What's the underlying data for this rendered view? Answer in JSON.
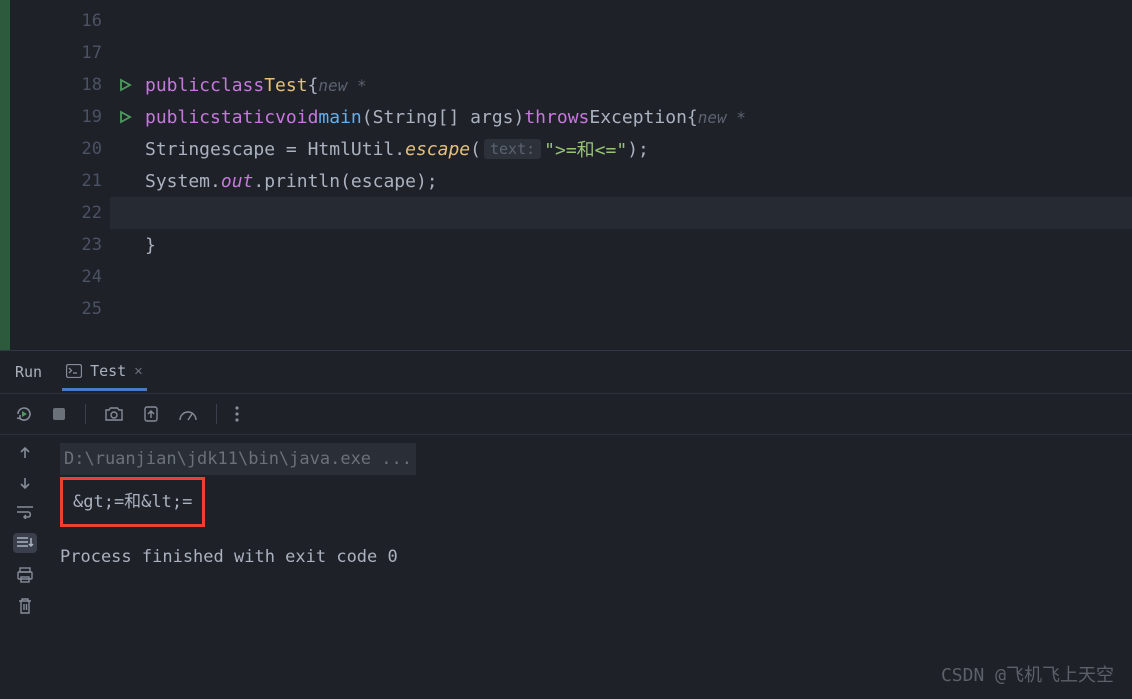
{
  "gutter": {
    "lines": [
      "16",
      "17",
      "18",
      "19",
      "20",
      "21",
      "22",
      "23",
      "24",
      "25"
    ]
  },
  "code": {
    "line18": {
      "kw1": "public",
      "kw2": "class",
      "name": "Test",
      "brace": "{",
      "hint": "new *"
    },
    "line19": {
      "kw1": "public",
      "kw2": "static",
      "kw3": "void",
      "method": "main",
      "params": "(String[] args)",
      "throws": "throws",
      "exc": "Exception",
      "brace": "{",
      "hint": "new *"
    },
    "line20": {
      "type": "String",
      "var": "escape",
      "eq": " = ",
      "cls": "HtmlUtil",
      "dot": ".",
      "method": "escape",
      "open": "(",
      "hint": "text:",
      "str": "\">=和<=\"",
      "close": ");"
    },
    "line21": {
      "sys": "System",
      "dot1": ".",
      "out": "out",
      "dot2": ".",
      "println": "println",
      "args": "(escape);"
    },
    "line23": {
      "brace": "}"
    }
  },
  "run": {
    "label": "Run",
    "tab_name": "Test"
  },
  "console": {
    "cmd": "D:\\ruanjian\\jdk11\\bin\\java.exe ...",
    "output": "&gt;=和&lt;=",
    "exit": "Process finished with exit code 0"
  },
  "watermark": "CSDN @飞机飞上天空"
}
